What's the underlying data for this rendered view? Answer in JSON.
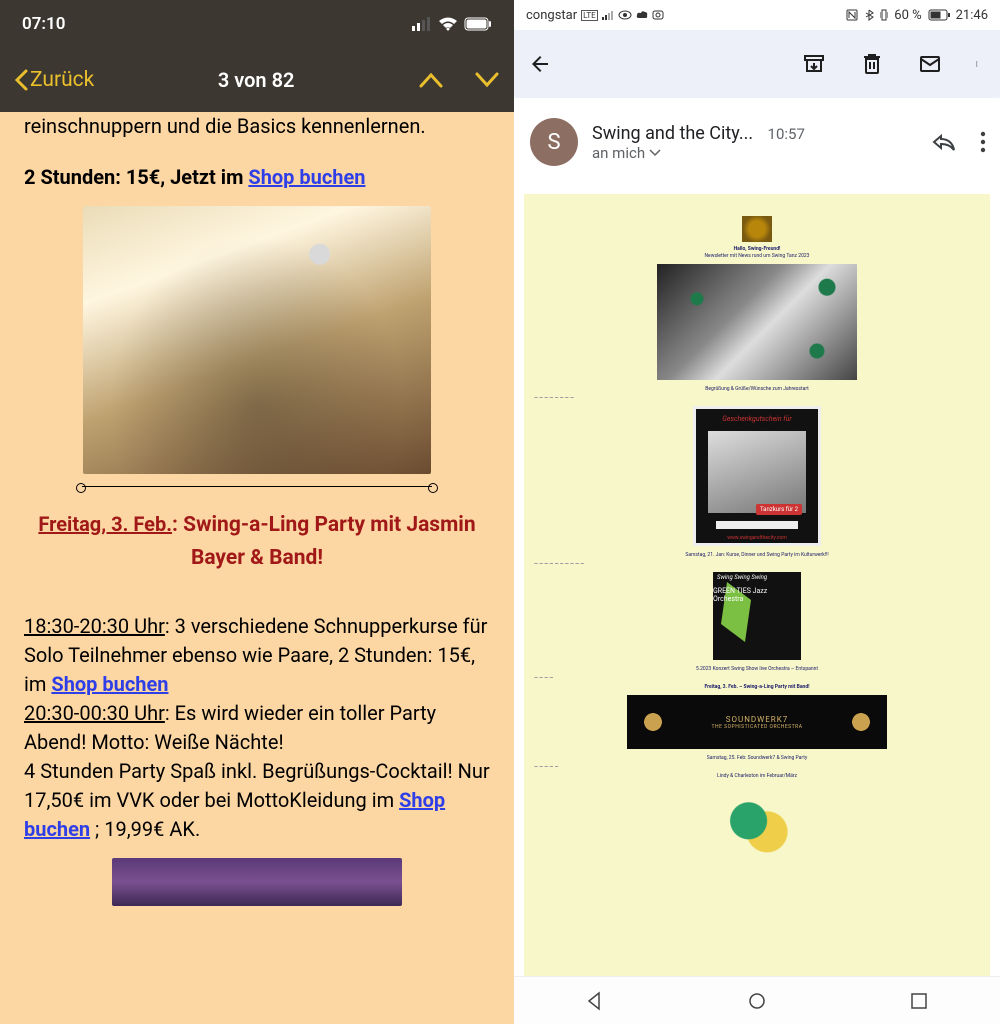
{
  "left_phone": {
    "status": {
      "time": "07:10"
    },
    "nav": {
      "back": "Zurück",
      "counter": "3 von 82"
    },
    "intro_fragment_top": "reinschnuppern und die Basics kennenlernen.",
    "price_line_prefix": "2 Stunden: 15€, Jetzt im ",
    "shop_link": "Shop buchen",
    "event": {
      "date": "Freitag, 3. Feb.",
      "title_rest": ": Swing-a-Ling Party mit Jasmin Bayer & Band!"
    },
    "schedule": {
      "slot1_time": "18:30-20:30 Uhr",
      "slot1_text": ": 3 verschiedene Schnupperkurse für Solo Teilnehmer ebenso wie Paare, 2 Stunden: 15€, im ",
      "slot2_time": "20:30-00:30 Uhr",
      "slot2_text": ": Es wird wieder ein toller Party Abend! Motto: Weiße Nächte!",
      "line3": "4 Stunden Party Spaß inkl. Begrüßungs-Cocktail! Nur 17,50€ im VVK oder bei MottoKleidung im ",
      "line3_tail": " ; 19,99€ AK."
    }
  },
  "right_phone": {
    "status": {
      "carrier": "congstar",
      "battery_pct": "60 %",
      "time": "21:46"
    },
    "sender": {
      "initial": "S",
      "name": "Swing and the City...",
      "time": "10:57",
      "to": "an mich"
    },
    "newsletter": {
      "greeting": "Hallo, Swing-Freund!",
      "subtitle": "Newsletter mit News rund um Swing Tanz 2023",
      "caption1": "Begrüßung & Grüße/Wünsche zum Jahresstart",
      "voucher_title": "Geschenkgutschein für",
      "voucher_badge": "Tanzkurs für 2",
      "voucher_url": "www.swingandthecity.com",
      "caption2": "Samstag, 21. Jan: Kurse, Dinner und Swing Party im Kulturwerk!!!",
      "poster_swing_top": "Swing Swing Swing",
      "poster_swing_band": "GREEN TIES Jazz Orchestra",
      "caption3": "5.2023 Konzert Swing Show live Orchestra – Entspannt",
      "caption4": "Freitag, 3. Feb. – Swing-a-Ling Party mit Band!",
      "poster_dark_title": "SOUNDWERK7",
      "poster_dark_sub": "THE SOPHISTICATED ORCHESTRA",
      "caption5": "Samstag, 25. Feb: Soundwerk7 & Swing Party",
      "caption6": "Lindy & Charleston im Februar/März"
    }
  }
}
